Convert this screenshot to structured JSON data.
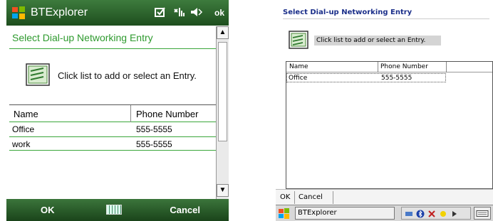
{
  "left": {
    "title": "BTExplorer",
    "status_ok": "ok",
    "heading": "Select Dial-up Networking Entry",
    "instruction": "Click list to add or select an Entry.",
    "columns": [
      "Name",
      "Phone Number"
    ],
    "rows": [
      {
        "name": "Office",
        "phone": "555-5555"
      },
      {
        "name": "work",
        "phone": "555-5555"
      }
    ],
    "soft_left": "OK",
    "soft_right": "Cancel",
    "icons": {
      "start": "windows-flag-icon",
      "status": [
        "message-icon",
        "signal-icon",
        "speaker-icon"
      ],
      "scroll_up": "▲",
      "scroll_down": "▼"
    }
  },
  "right": {
    "heading": "Select Dial-up Networking Entry",
    "instruction": "Click list to add or select an Entry.",
    "columns": [
      "Name",
      "Phone Number"
    ],
    "rows": [
      {
        "name": "Office",
        "phone": "555-5555"
      }
    ],
    "menu": [
      "OK",
      "Cancel"
    ],
    "taskbar_app": "BTExplorer"
  },
  "colors": {
    "wm_green": "#2e9a2e",
    "title_green": "#2f6a2f",
    "classic_heading": "#1b2f8a"
  }
}
